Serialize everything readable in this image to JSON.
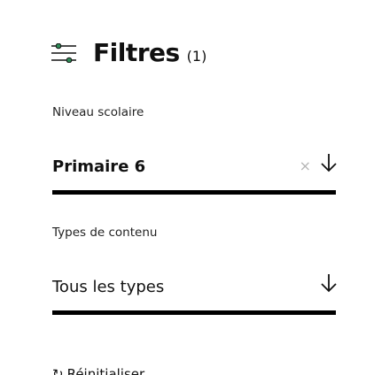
{
  "header": {
    "icon": "filter-sliders-icon",
    "title": "Filtres",
    "count": "(1)"
  },
  "filters": [
    {
      "label": "Niveau scolaire",
      "value": "Primaire 6",
      "clear_glyph": "×",
      "arrow_icon": "arrow-down-icon"
    },
    {
      "label": "Types de contenu",
      "value": "Tous les types",
      "arrow_icon": "arrow-down-icon"
    }
  ],
  "reset": {
    "icon_glyph": "↻",
    "label": "Réinitialiser"
  },
  "colors": {
    "accent_green": "#2e8b57",
    "text": "#111111",
    "muted": "#b5b5b5"
  }
}
